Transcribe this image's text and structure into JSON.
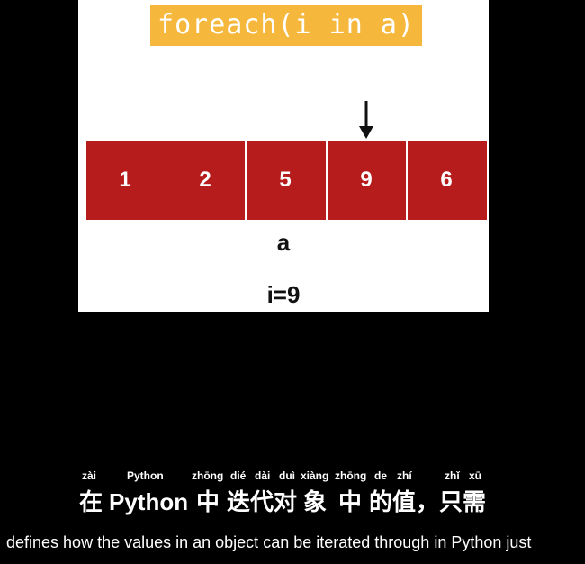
{
  "slide": {
    "code": "foreach(i in a)",
    "array": {
      "name": "a",
      "values": [
        "1",
        "2",
        "5",
        "9",
        "6"
      ]
    },
    "iteration": "i=9",
    "banner_color": "#f5b83c",
    "cell_color": "#b71c1c"
  },
  "subtitles": {
    "pinyin": [
      "zài",
      "Python",
      "zhōng",
      "dié",
      "dài",
      "duì",
      "xiàng",
      "zhōng",
      "de",
      "zhí",
      "zhǐ",
      "xū"
    ],
    "chinese": [
      "在",
      "Python",
      "中",
      "迭代对",
      "象",
      "中",
      "的值，只需"
    ],
    "english": "defines how the values in an object can be iterated through in Python just"
  }
}
